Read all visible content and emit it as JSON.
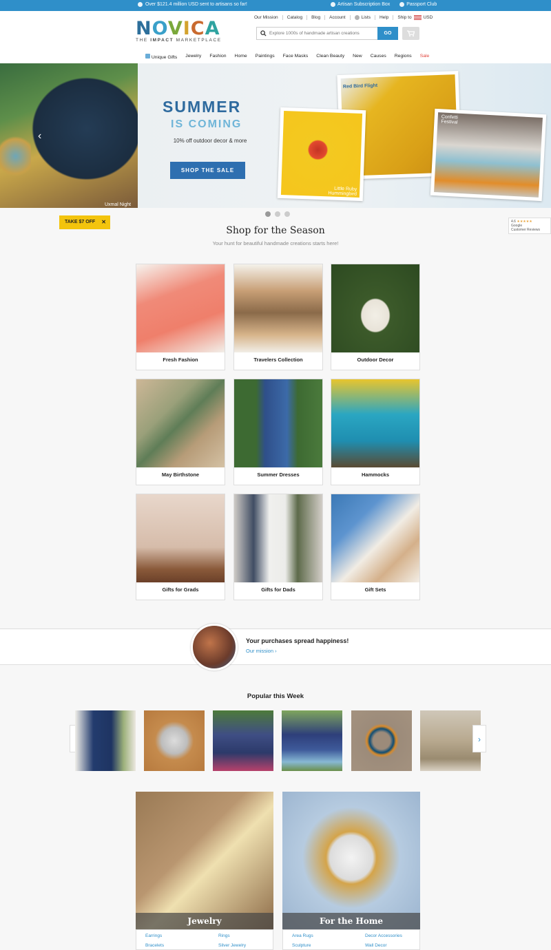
{
  "topbar": {
    "impact": "Over $121.4 million USD sent to artisans so far!",
    "subscription": "Artisan Subscription Box",
    "passport": "Passport Club"
  },
  "logo": {
    "word": "NOVICA",
    "tagline_pre": "THE ",
    "tagline_bold": "IMPACT",
    "tagline_post": " MARKETPLACE"
  },
  "utilnav": [
    "Our Mission",
    "Catalog",
    "Blog",
    "Account",
    "Lists",
    "Help",
    "Ship to",
    "USD"
  ],
  "search": {
    "placeholder": "Explore 1000s of handmade artisan creations",
    "go": "GO"
  },
  "mainnav": [
    "Unique Gifts",
    "Jewelry",
    "Fashion",
    "Home",
    "Paintings",
    "Face Masks",
    "Clean Beauty",
    "New",
    "Causes",
    "Regions",
    "Sale"
  ],
  "hero": {
    "title": "SUMMER",
    "title2": "IS COMING",
    "sub": "10% off outdoor decor & more",
    "cta": "SHOP THE SALE",
    "scene_label": "Uxmal Night",
    "card1": "Little Ruby Hummingbird",
    "card2": "Red Bird Flight",
    "card3": "Confetti Festival",
    "slide_count": 3,
    "active_slide": 1
  },
  "promo": {
    "take7": "TAKE $7 OFF",
    "close": "✕"
  },
  "reviews": {
    "score": "4.6",
    "stars": "★★★★★",
    "provider": "Google",
    "label": "Customer Reviews"
  },
  "section": {
    "title": "Shop for the Season",
    "subtitle": "Your hunt for beautiful handmade creations starts here!"
  },
  "tiles": [
    {
      "label": "Fresh Fashion",
      "color": "#f08a78"
    },
    {
      "label": "Travelers Collection",
      "color": "#b58a5e"
    },
    {
      "label": "Outdoor Decor",
      "color": "#3c5a2a"
    },
    {
      "label": "May Birthstone",
      "color": "#b89b7a"
    },
    {
      "label": "Summer Dresses",
      "color": "#2f4f8a"
    },
    {
      "label": "Hammocks",
      "color": "#2aa6c2"
    },
    {
      "label": "Gifts for Grads",
      "color": "#c9a994"
    },
    {
      "label": "Gifts for Dads",
      "color": "#c8c4c0"
    },
    {
      "label": "Gift Sets",
      "color": "#3c79b6"
    }
  ],
  "mission": {
    "headline": "Your purchases spread happiness!",
    "link": "Our mission ›"
  },
  "popular": {
    "title": "Popular this Week",
    "items": [
      "#233c6e",
      "#c58b4d",
      "#3f4e84",
      "#2e3f7a",
      "#9c8b7a",
      "#b8a98f"
    ]
  },
  "big_categories": [
    {
      "label": "Jewelry",
      "links": [
        "Earrings",
        "Rings",
        "Bracelets",
        "Silver Jewelry"
      ]
    },
    {
      "label": "For the Home",
      "links": [
        "Area Rugs",
        "Decor Accessories",
        "Sculpture",
        "Wall Decor"
      ]
    }
  ]
}
